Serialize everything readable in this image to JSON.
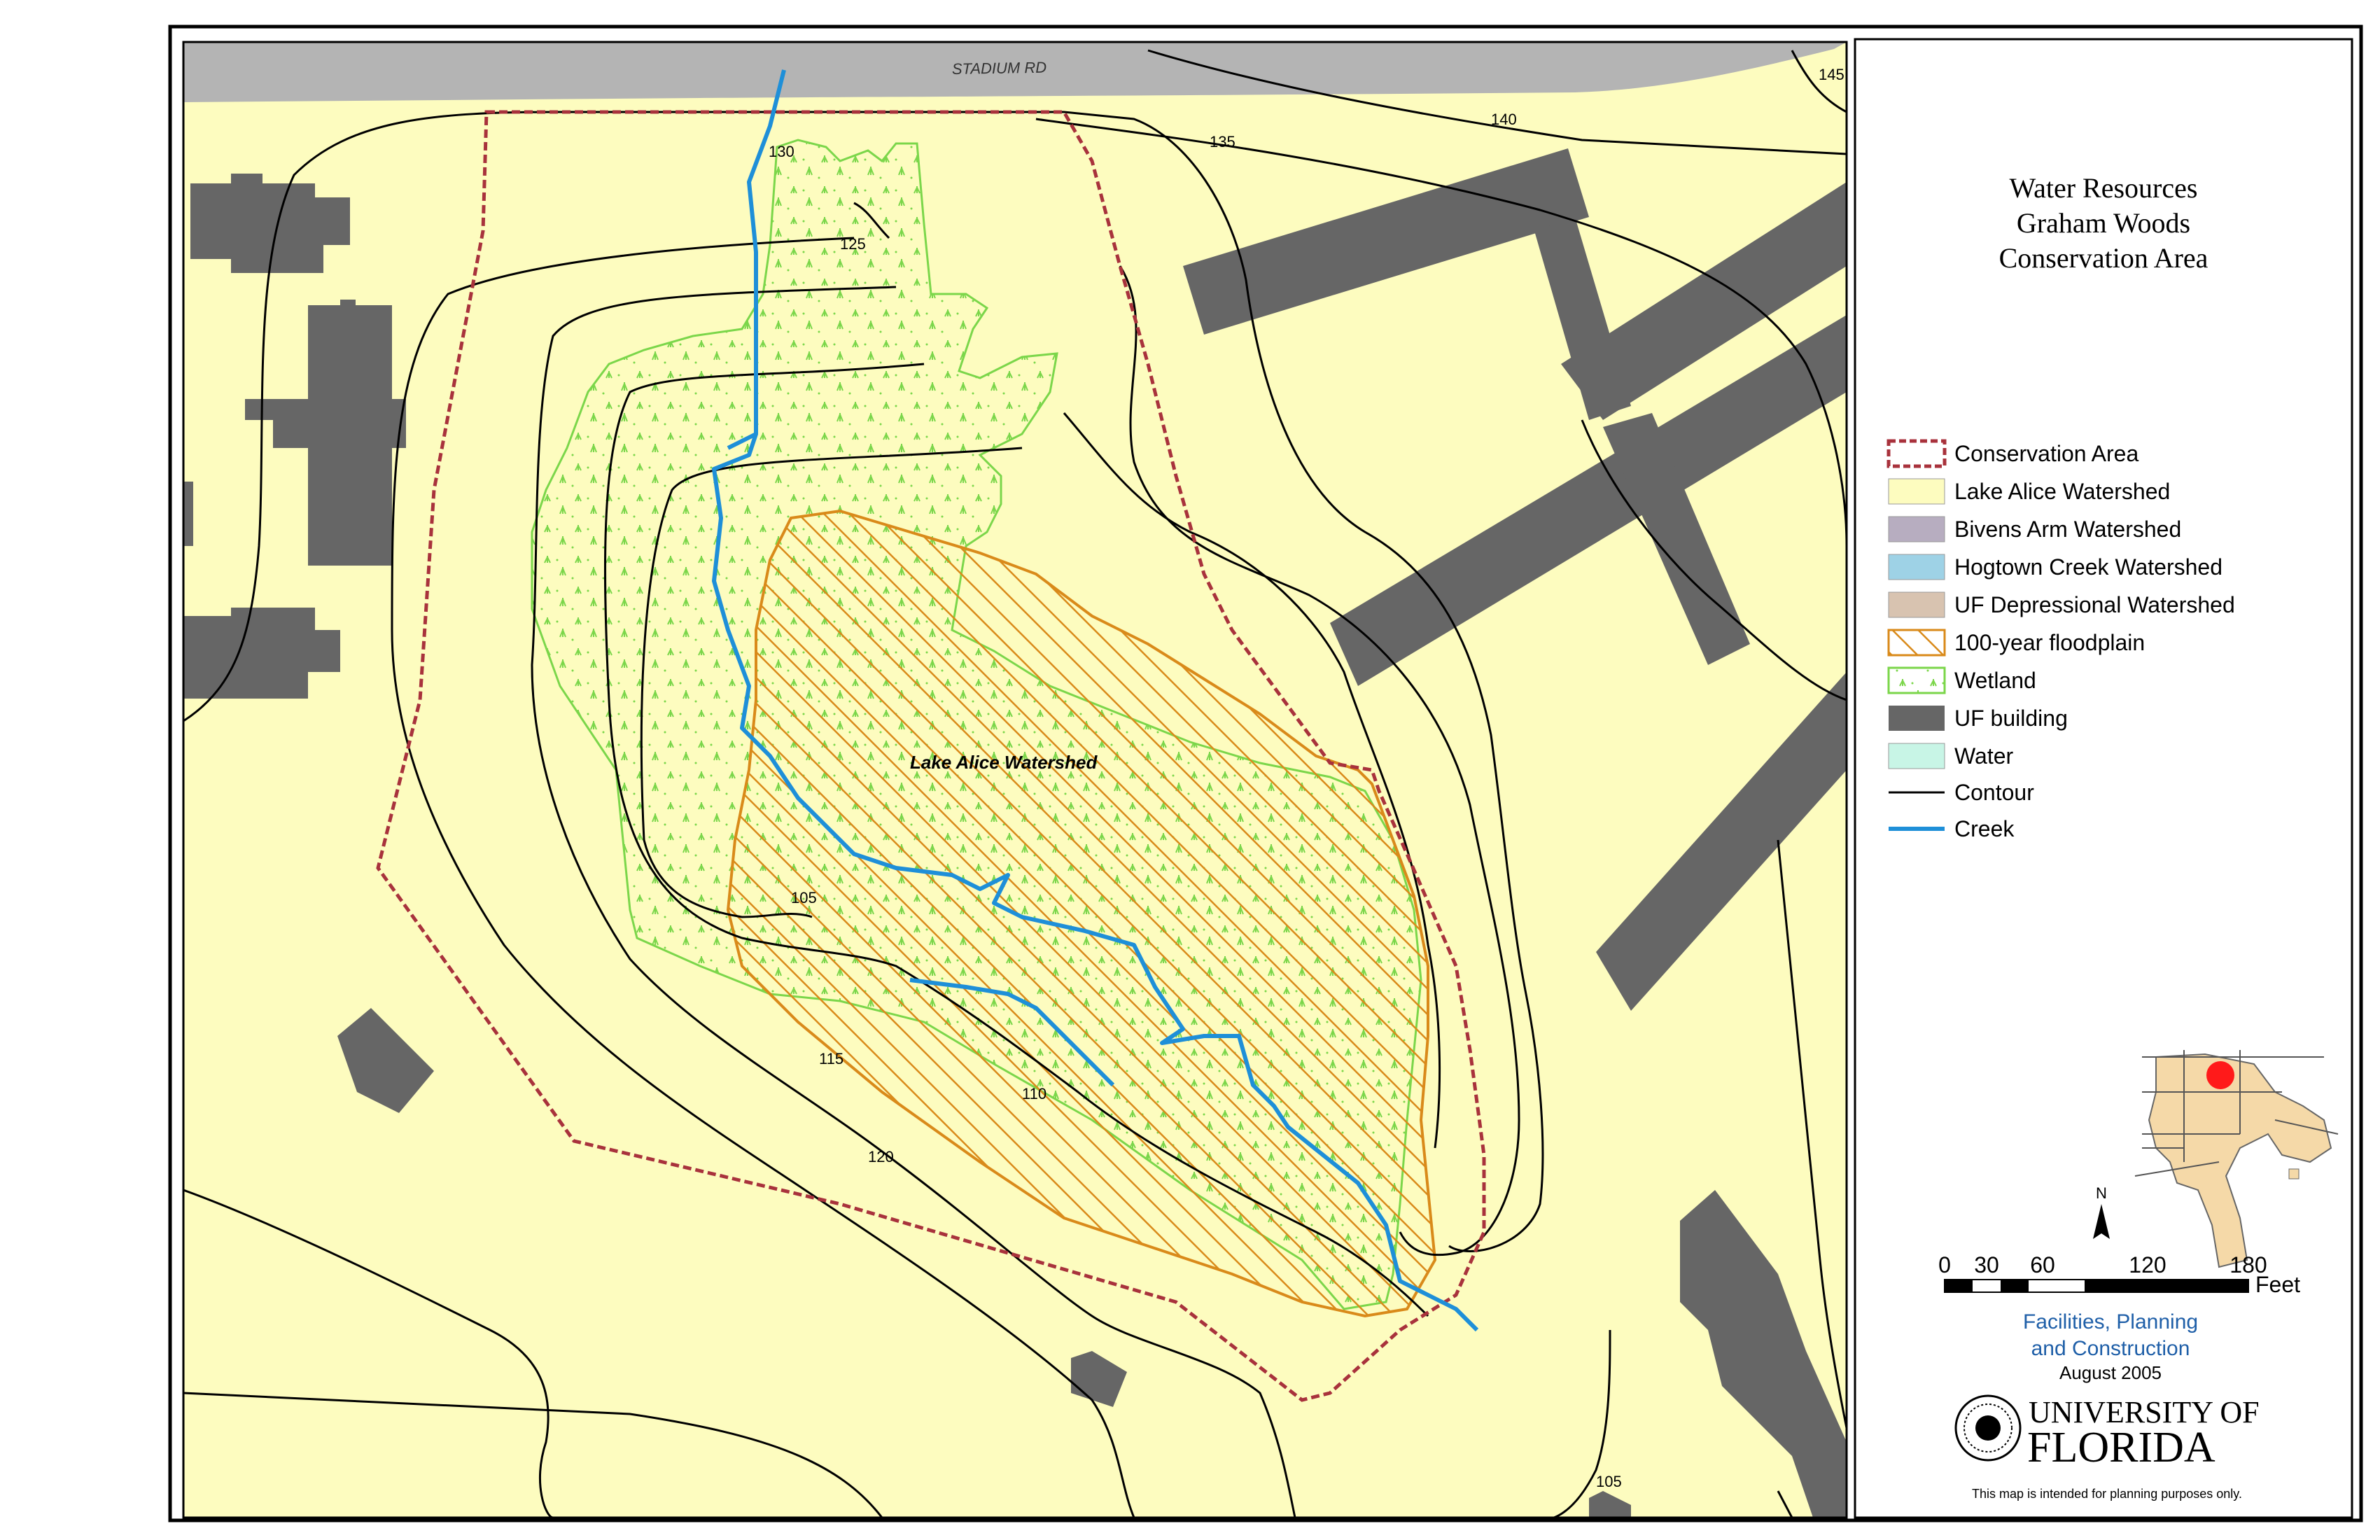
{
  "map": {
    "road_label": "STADIUM RD",
    "area_label": "Lake Alice Watershed",
    "contour_labels": [
      "145",
      "140",
      "135",
      "130",
      "125",
      "105",
      "115",
      "110",
      "120",
      "105"
    ]
  },
  "panel": {
    "title_lines": [
      "Water Resources",
      "Graham Woods",
      "Conservation Area"
    ],
    "legend": [
      {
        "label": "Conservation Area",
        "symbol": "dashed-box",
        "color": "#a8323c"
      },
      {
        "label": "Lake Alice Watershed",
        "symbol": "fill",
        "color": "#fdfcbf"
      },
      {
        "label": "Bivens Arm Watershed",
        "symbol": "fill",
        "color": "#b7adc0"
      },
      {
        "label": "Hogtown Creek Watershed",
        "symbol": "fill",
        "color": "#9ed2e6"
      },
      {
        "label": "UF Depressional Watershed",
        "symbol": "fill",
        "color": "#d8c3b0"
      },
      {
        "label": "100-year floodplain",
        "symbol": "hatch",
        "color": "#d98a1a"
      },
      {
        "label": "Wetland",
        "symbol": "wetland",
        "color": "#7bd64a"
      },
      {
        "label": "UF building",
        "symbol": "fill",
        "color": "#666666"
      },
      {
        "label": "Water",
        "symbol": "fill",
        "color": "#c8f5e6"
      },
      {
        "label": "Contour",
        "symbol": "line",
        "color": "#000000"
      },
      {
        "label": "Creek",
        "symbol": "line",
        "color": "#1e8fd8"
      }
    ],
    "scale": {
      "ticks": [
        "0",
        "30",
        "60",
        "120",
        "180"
      ],
      "unit": "Feet"
    },
    "dept_lines": [
      "Facilities, Planning",
      "and Construction"
    ],
    "date": "August 2005",
    "university_top": "UNIVERSITY OF",
    "university_bottom": "FLORIDA",
    "disclaimer": "This map is intended for planning purposes only.",
    "north_label": "N"
  },
  "colors": {
    "watershed": "#fdfcbf",
    "road": "#b4b4b4",
    "building": "#666666",
    "wetland": "#7bd64a",
    "floodplain": "#d98a1a",
    "creek": "#1e8fd8",
    "conservation": "#a8323c",
    "dept_text": "#1f5fa8",
    "locator_red": "#ff1a1a",
    "locator_fill": "#f5d9a8"
  }
}
